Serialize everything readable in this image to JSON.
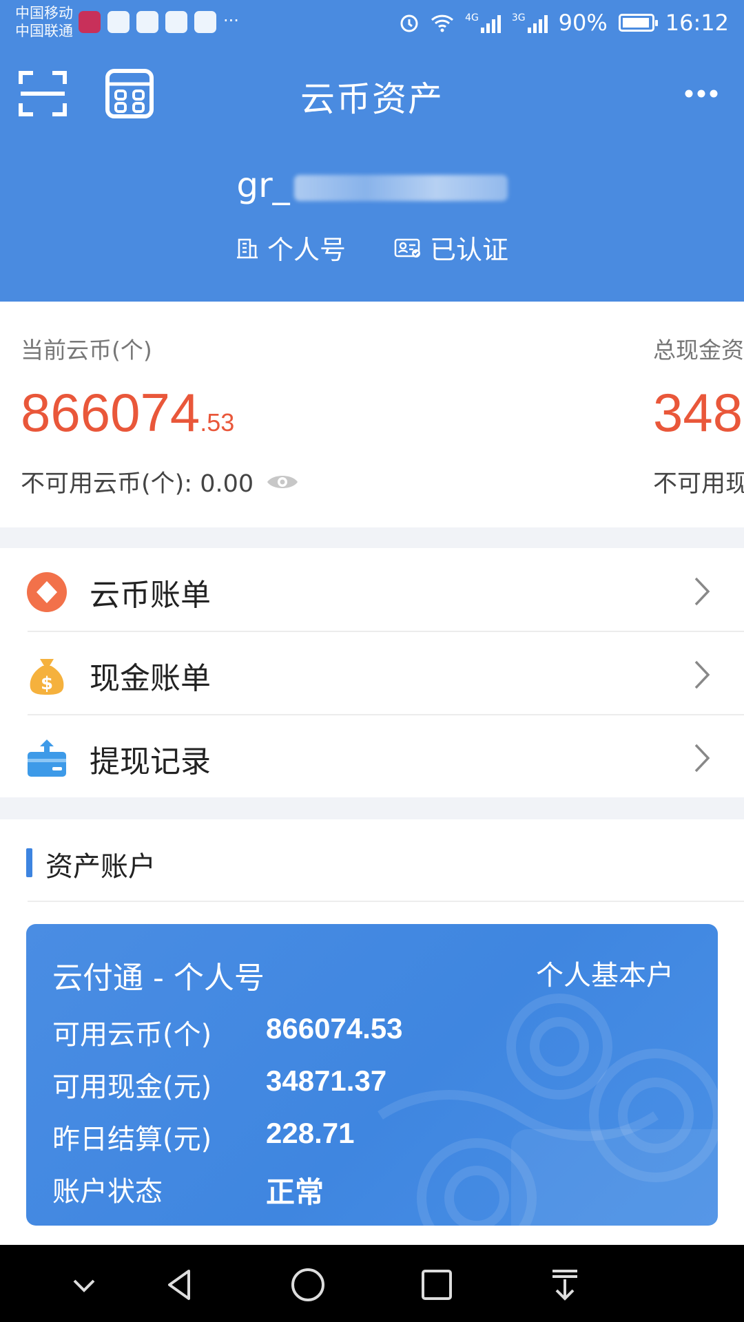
{
  "status_bar": {
    "carrier_1": "中国移动",
    "carrier_2": "中国联通",
    "network_1": "4G",
    "network_2": "3G",
    "battery": "90%",
    "time": "16:12"
  },
  "toolbar": {
    "title": "云币资产",
    "scan_icon": "scan-icon",
    "calculator_icon": "calculator-icon",
    "more_icon": "more-dots-icon"
  },
  "account": {
    "id_prefix": "gr_",
    "type_label": "个人号",
    "verified_label": "已认证"
  },
  "balances": {
    "coin_label": "当前云币(个)",
    "coin_value_int": "866074",
    "coin_value_dec": ".53",
    "coin_unavailable": "不可用云币(个): 0.00",
    "cash_label": "总现金资",
    "cash_value": "348",
    "cash_unavailable": "不可用现"
  },
  "menu": {
    "items": [
      {
        "label": "云币账单",
        "icon": "coin-bill-icon"
      },
      {
        "label": "现金账单",
        "icon": "money-bag-icon"
      },
      {
        "label": "提现记录",
        "icon": "withdraw-icon"
      }
    ]
  },
  "assets": {
    "section_title": "资产账户",
    "card": {
      "title": "云付通 - 个人号",
      "type": "个人基本户",
      "rows": [
        {
          "key": "可用云币(个)",
          "value": "866074.53"
        },
        {
          "key": "可用现金(元)",
          "value": "34871.37"
        },
        {
          "key": "昨日结算(元)",
          "value": "228.71"
        },
        {
          "key": "账户状态",
          "value": "正常"
        }
      ]
    }
  },
  "colors": {
    "header_blue": "#4a8be0",
    "amount_red": "#e9573a",
    "card_blue": "#3f86e0"
  }
}
